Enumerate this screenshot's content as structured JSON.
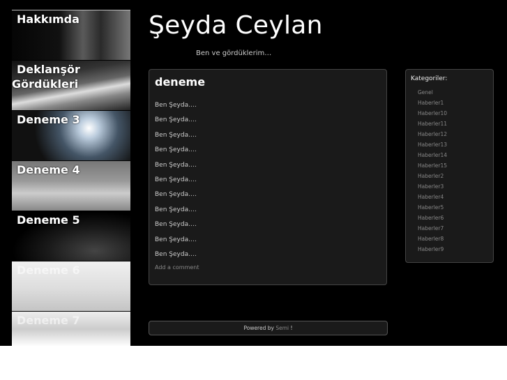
{
  "header": {
    "title": "Şeyda Ceylan",
    "tagline": "Ben ve gördüklerim…"
  },
  "nav": {
    "items": [
      {
        "label": "Hakkımda"
      },
      {
        "label_line1": "Deklanşör",
        "label_line2": "Gördükleri"
      },
      {
        "label": "Deneme 3"
      },
      {
        "label": "Deneme 4"
      },
      {
        "label": "Deneme 5"
      },
      {
        "label": "Deneme 6"
      },
      {
        "label": "Deneme 7"
      }
    ]
  },
  "post": {
    "title": "deneme",
    "lines": [
      "Ben Şeyda….",
      "Ben Şeyda….",
      "Ben Şeyda….",
      "Ben Şeyda….",
      "Ben Şeyda….",
      "Ben Şeyda….",
      "Ben Şeyda….",
      "Ben Şeyda….",
      "Ben Şeyda….",
      "Ben Şeyda….",
      "Ben Şeyda…."
    ],
    "add_comment": "Add a comment"
  },
  "sidebar": {
    "heading": "Kategoriler:",
    "categories": [
      "Genel",
      "Haberler1",
      "Haberler10",
      "Haberler11",
      "Haberler12",
      "Haberler13",
      "Haberler14",
      "Haberler15",
      "Haberler2",
      "Haberler3",
      "Haberler4",
      "Haberler5",
      "Haberler6",
      "Haberler7",
      "Haberler8",
      "Haberler9"
    ]
  },
  "footer": {
    "powered_by": "Powered by",
    "link": "Semi",
    "suffix": "!"
  }
}
